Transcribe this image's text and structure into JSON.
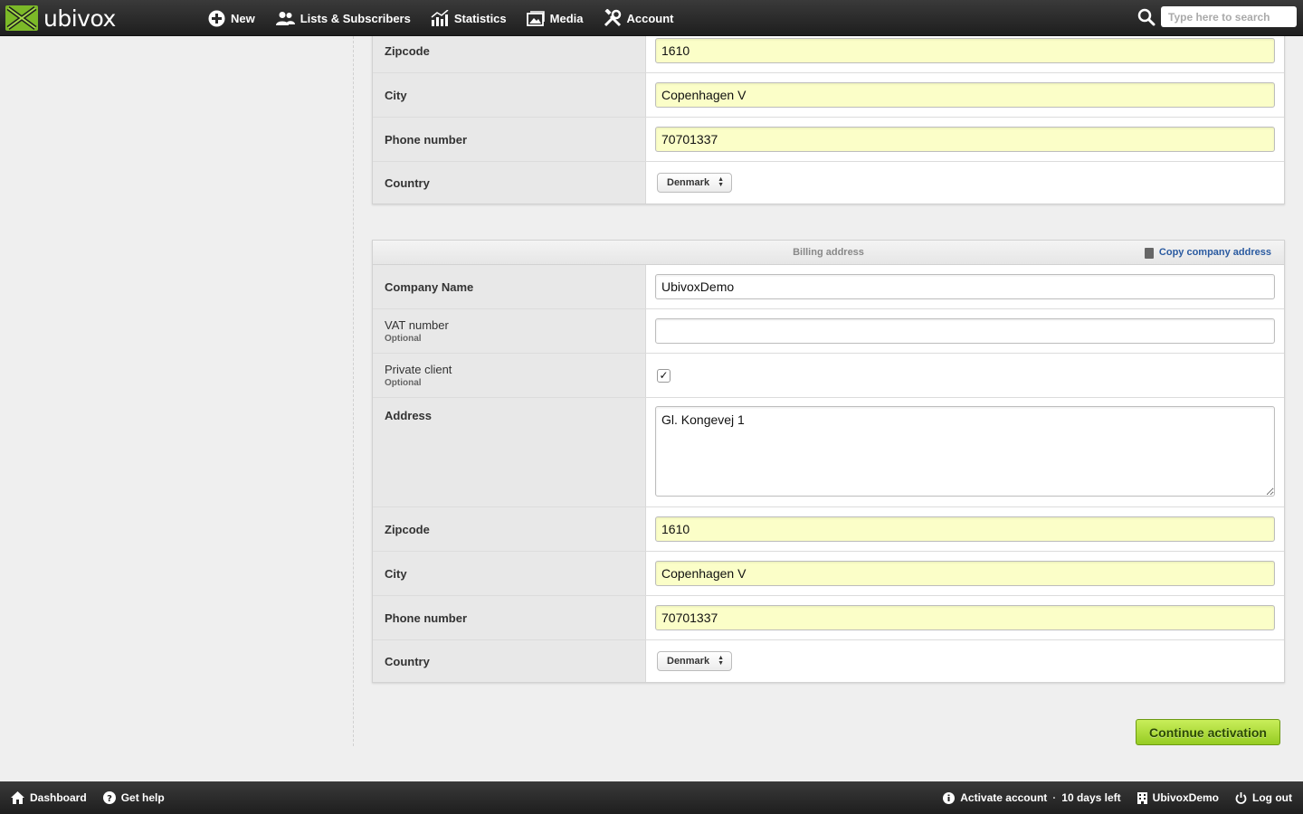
{
  "topbar": {
    "brand": "ubivox",
    "nav": [
      {
        "label": "New",
        "icon": "plus-circle-icon"
      },
      {
        "label": "Lists & Subscribers",
        "icon": "users-icon"
      },
      {
        "label": "Statistics",
        "icon": "chart-icon"
      },
      {
        "label": "Media",
        "icon": "image-icon"
      },
      {
        "label": "Account",
        "icon": "tools-icon"
      }
    ],
    "search_placeholder": "Type here to search"
  },
  "company_panel": {
    "rows": [
      {
        "label": "Zipcode",
        "value": "1610"
      },
      {
        "label": "City",
        "value": "Copenhagen V"
      },
      {
        "label": "Phone number",
        "value": "70701337"
      },
      {
        "label": "Country",
        "value": "Denmark"
      }
    ]
  },
  "billing_panel": {
    "title": "Billing address",
    "copy_link": "Copy company address",
    "company_name": {
      "label": "Company Name",
      "value": "UbivoxDemo"
    },
    "vat": {
      "label": "VAT number",
      "optional": "Optional",
      "value": ""
    },
    "private": {
      "label": "Private client",
      "optional": "Optional",
      "checked": "✓"
    },
    "address": {
      "label": "Address",
      "value": "Gl. Kongevej 1"
    },
    "zipcode": {
      "label": "Zipcode",
      "value": "1610"
    },
    "city": {
      "label": "City",
      "value": "Copenhagen V"
    },
    "phone": {
      "label": "Phone number",
      "value": "70701337"
    },
    "country": {
      "label": "Country",
      "value": "Denmark"
    }
  },
  "continue_label": "Continue activation",
  "bottombar": {
    "dashboard": "Dashboard",
    "help": "Get help",
    "activate": "Activate account",
    "separator": "·",
    "days_left": "10 days left",
    "org": "UbivoxDemo",
    "logout": "Log out"
  },
  "colors": {
    "accent_green": "#96cc23",
    "link_blue": "#2a5aa0",
    "field_yellow": "#fbfec8"
  }
}
